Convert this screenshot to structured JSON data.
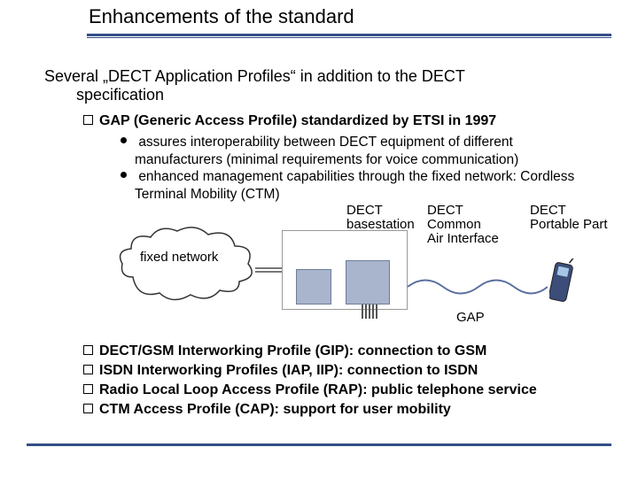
{
  "title": "Enhancements of the standard",
  "lead_line1": "Several „DECT Application Profiles“ in addition to the DECT",
  "lead_line2": "specification",
  "bullet_gap": "GAP (Generic Access Profile) standardized by ETSI in 1997",
  "dots": {
    "d1a": "assures interoperability between DECT equipment of different",
    "d1b": "manufacturers (minimal requirements for voice communication)",
    "d2a": "enhanced management capabilities through the fixed network: Cordless",
    "d2b": "Terminal Mobility (CTM)"
  },
  "diagram": {
    "fixed_network": "fixed network",
    "basestation_l1": "DECT",
    "basestation_l2": "basestation",
    "common_l1": "DECT",
    "common_l2": "Common",
    "common_l3": "Air Interface",
    "pp_l1": "DECT",
    "pp_l2": "Portable Part",
    "gap": "GAP"
  },
  "profiles": {
    "gip": "DECT/GSM Interworking Profile (GIP): connection to GSM",
    "iap": "ISDN Interworking Profiles (IAP, IIP): connection to ISDN",
    "rap": "Radio Local Loop Access Profile (RAP): public telephone service",
    "cap": "CTM Access Profile (CAP): support for user mobility"
  }
}
